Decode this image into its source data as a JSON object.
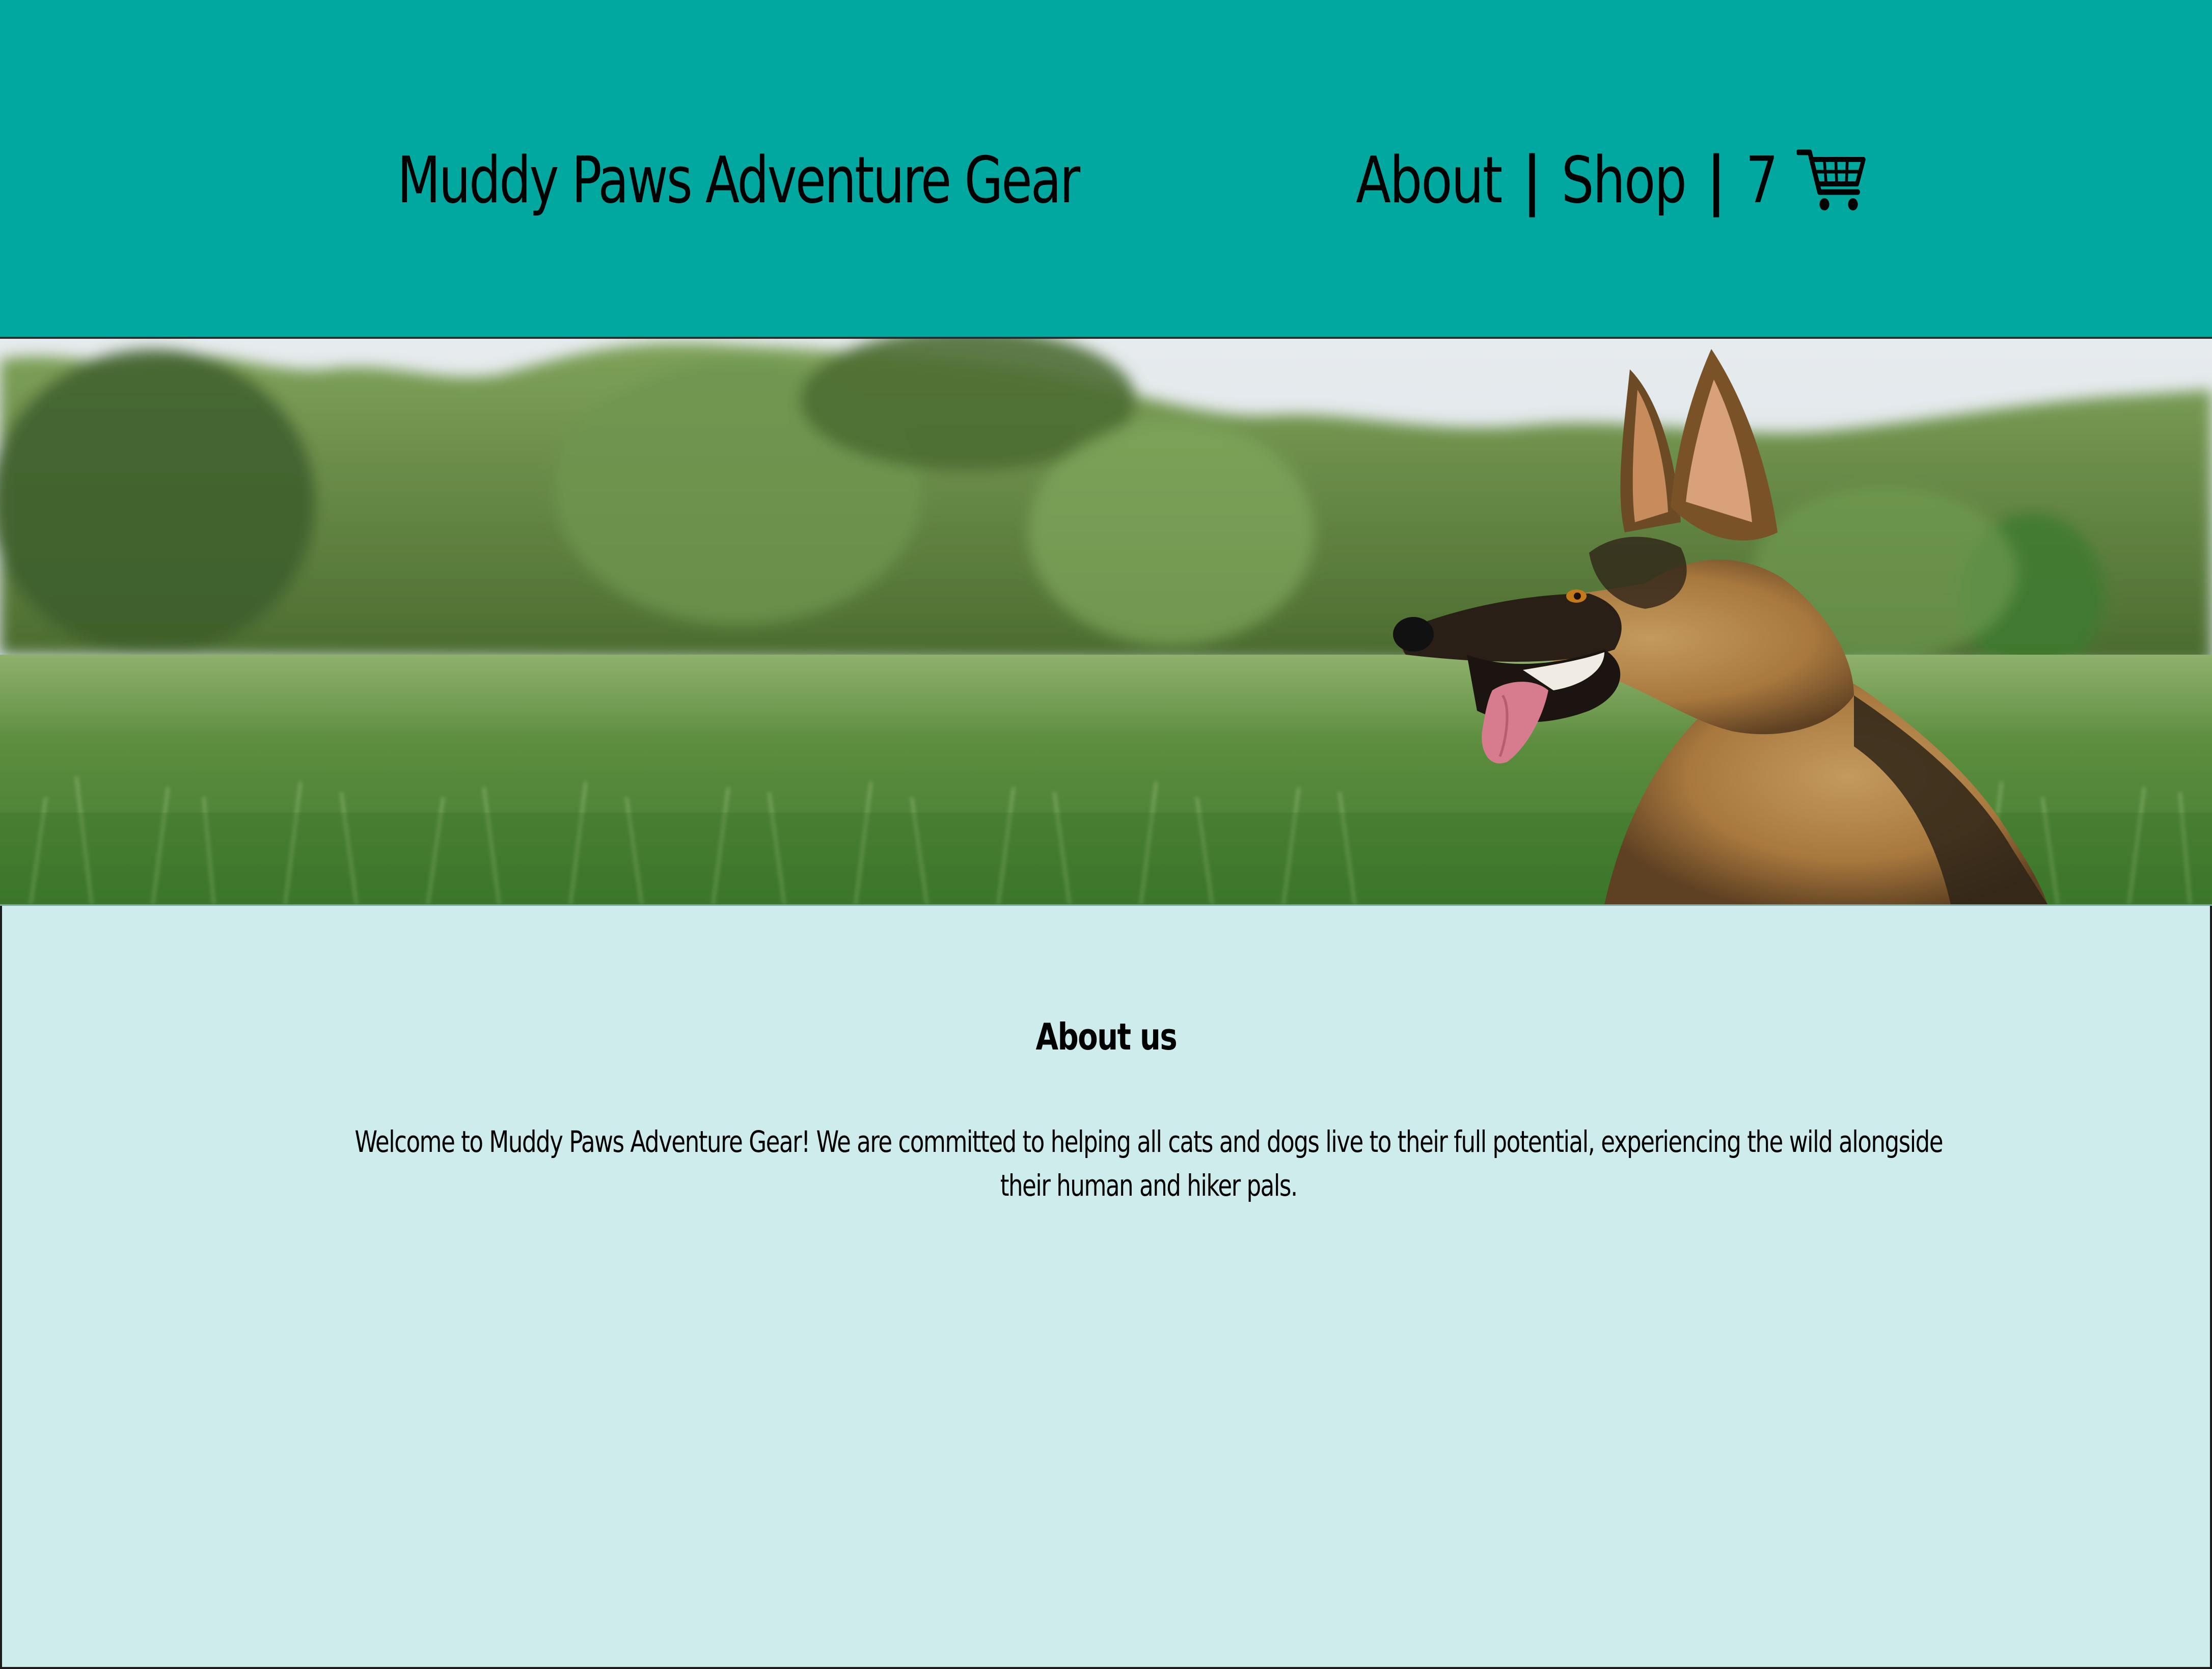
{
  "header": {
    "brand": "Muddy Paws Adventure Gear",
    "nav": {
      "about_label": "About",
      "separator": "|",
      "shop_label": "Shop",
      "cart_count": "7",
      "cart_icon": "shopping-cart-icon"
    }
  },
  "hero": {
    "image": "german-shepherd-in-grass-field-photo"
  },
  "about": {
    "title": "About us",
    "body": "Welcome to Muddy Paws Adventure Gear! We are committed to helping all cats and dogs live to their full potential, experiencing the wild alongside their human and hiker pals."
  },
  "colors": {
    "header_bg": "#00a89f",
    "page_bg": "#ceecec",
    "text": "#000000"
  }
}
